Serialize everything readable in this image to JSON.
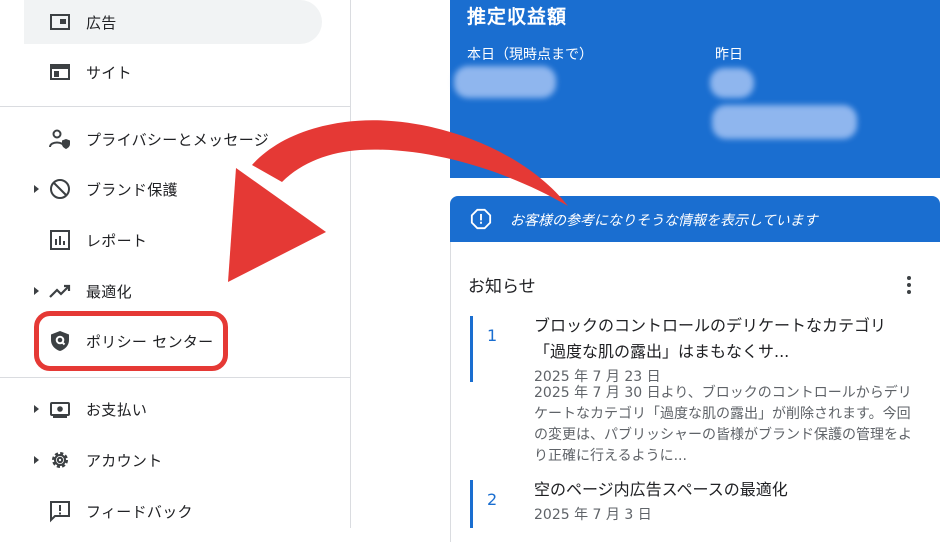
{
  "sidebar": {
    "items": [
      {
        "label": "広告",
        "icon": "ad-icon"
      },
      {
        "label": "サイト",
        "icon": "site-icon"
      },
      {
        "label": "プライバシーとメッセージ",
        "icon": "privacy-icon"
      },
      {
        "label": "ブランド保護",
        "icon": "block-icon"
      },
      {
        "label": "レポート",
        "icon": "report-icon"
      },
      {
        "label": "最適化",
        "icon": "trending-icon"
      },
      {
        "label": "ポリシー センター",
        "icon": "policy-shield-icon"
      },
      {
        "label": "お支払い",
        "icon": "payment-icon"
      },
      {
        "label": "アカウント",
        "icon": "gear-icon"
      },
      {
        "label": "フィードバック",
        "icon": "feedback-icon"
      }
    ]
  },
  "earnings": {
    "title": "推定収益額",
    "today_label": "本日（現時点まで）",
    "yesterday_label": "昨日"
  },
  "info_bar": {
    "text": "お客様の参考になりそうな情報を表示しています"
  },
  "notices": {
    "title": "お知らせ",
    "items": [
      {
        "num": "1",
        "title": "ブロックのコントロールのデリケートなカテゴリ「過度な肌の露出」はまもなくサ...",
        "date": "2025 年 7 月 23 日",
        "desc": "2025 年 7 月 30 日より、ブロックのコントロールからデリケートなカテゴリ「過度な肌の露出」が削除されます。今回の変更は、パブリッシャーの皆様がブランド保護の管理をより正確に行えるように..."
      },
      {
        "num": "2",
        "title": "空のページ内広告スペースの最適化",
        "date": "2025 年 7 月 3 日"
      }
    ]
  },
  "colors": {
    "brand_blue": "#1a6ed0",
    "highlight_red": "#e53935"
  }
}
